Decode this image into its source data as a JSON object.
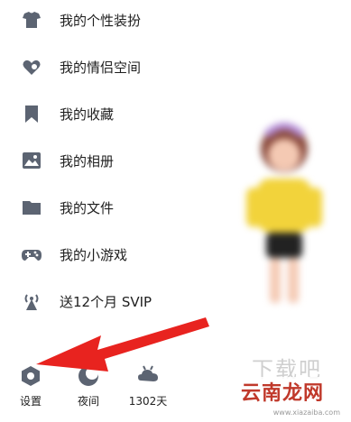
{
  "menu": {
    "items": [
      {
        "label": "我的个性装扮",
        "icon": "shirt-icon"
      },
      {
        "label": "我的情侣空间",
        "icon": "couple-heart-icon"
      },
      {
        "label": "我的收藏",
        "icon": "bookmark-icon"
      },
      {
        "label": "我的相册",
        "icon": "photo-icon"
      },
      {
        "label": "我的文件",
        "icon": "folder-icon"
      },
      {
        "label": "我的小游戏",
        "icon": "gamepad-icon"
      },
      {
        "label": "送12个月 SVIP",
        "icon": "broadcast-tower-icon"
      }
    ]
  },
  "bottom_bar": {
    "items": [
      {
        "label": "设置",
        "icon": "settings-hexagon-icon"
      },
      {
        "label": "夜间",
        "icon": "moon-icon"
      },
      {
        "label": "1302天",
        "icon": "cloud-weather-icon"
      }
    ]
  },
  "watermark": {
    "big_text": "下载吧",
    "brand": "云南龙网",
    "url": "www.xiazaiba.com"
  },
  "colors": {
    "icon_gray": "#5c6472",
    "arrow_red": "#e8231f",
    "brand_red": "#c0392b"
  }
}
